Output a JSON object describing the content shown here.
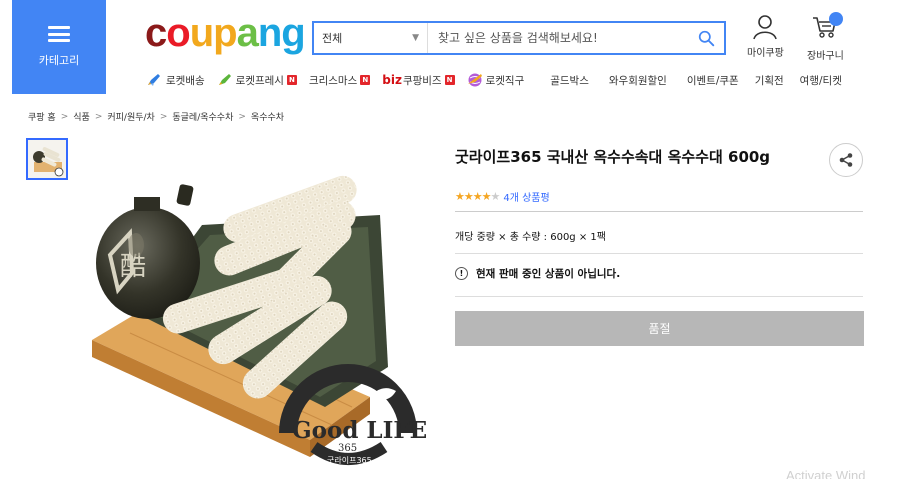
{
  "header": {
    "category_label": "카테고리",
    "logo": {
      "c": "c",
      "o1": "o",
      "u": "u",
      "p": "p",
      "a": "a",
      "n": "n",
      "g": "g"
    },
    "logo_colors": {
      "c": "#8b1a1a",
      "o1": "#ea1b27",
      "u": "#f2a81d",
      "p": "#f2a81d",
      "a": "#6cbf46",
      "n": "#1ba5e0",
      "g": "#1ba5e0"
    },
    "search": {
      "category": "전체",
      "placeholder": "찾고 싶은 상품을 검색해보세요!"
    },
    "my_coupang": "마이쿠팡",
    "cart": "장바구니",
    "accent": "#4285f4"
  },
  "gnb": [
    {
      "label": "로켓배송",
      "icon": "rocket-icon",
      "new": false
    },
    {
      "label": "로켓프레시",
      "icon": "rocket-fresh-icon",
      "new": true
    },
    {
      "label": "크리스마스",
      "icon": "",
      "new": true
    },
    {
      "label": "쿠팡비즈",
      "icon": "biz-logo",
      "new": true
    },
    {
      "label": "로켓직구",
      "icon": "globe-icon",
      "new": false
    },
    {
      "label": "골드박스",
      "icon": "",
      "new": false
    },
    {
      "label": "와우회원할인",
      "icon": "",
      "new": false
    },
    {
      "label": "이벤트/쿠폰",
      "icon": "",
      "new": false
    },
    {
      "label": "기획전",
      "icon": "",
      "new": false
    },
    {
      "label": "여행/티켓",
      "icon": "",
      "new": false
    }
  ],
  "gnb_extra": {
    "biz": "biz",
    "new_badge": "N"
  },
  "breadcrumb": [
    "쿠팡 홈",
    "식품",
    "커피/원두/차",
    "동글레/옥수수차",
    "옥수수차"
  ],
  "breadcrumb_sep": ">",
  "product": {
    "title": "굿라이프365 국내산 옥수수속대 옥수수대 600g",
    "rating_stars": 4,
    "rating_max": 5,
    "review_count": "4개 상품평",
    "option": "개당 중량 × 총 수량 : 600g × 1팩",
    "notice": "현재 판매 중인 상품이 아닙니다.",
    "notice_icon": "!",
    "button": "품절"
  },
  "brand_mark": {
    "name": "Good LIFE",
    "number": "365",
    "korean": "굿라이프365"
  },
  "watermark": "Activate Wind"
}
